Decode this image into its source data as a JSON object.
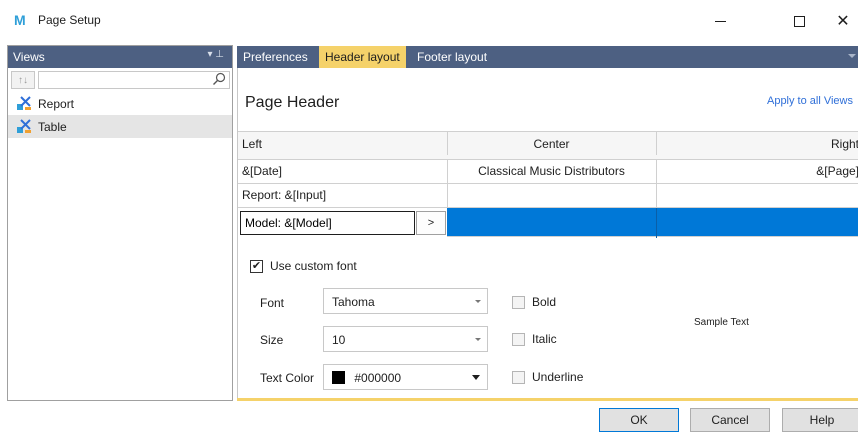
{
  "window": {
    "title": "Page Setup",
    "app_logo": "M",
    "minimize_icon": "minimize-icon",
    "maximize_icon": "maximize-icon",
    "close_icon": "close-icon",
    "close_glyph": "✕"
  },
  "views_panel": {
    "title": "Views",
    "header_controls": "▾ ⊥",
    "sort_glyph": "↑↓",
    "search_placeholder": "",
    "search_icon": "search-icon",
    "items": [
      {
        "label": "Report",
        "icon": "view-icon",
        "selected": false
      },
      {
        "label": "Table",
        "icon": "view-icon",
        "selected": true
      }
    ]
  },
  "tabs": [
    {
      "label": "Preferences",
      "active": false
    },
    {
      "label": "Header layout",
      "active": true
    },
    {
      "label": "Footer layout",
      "active": false
    }
  ],
  "header_layout": {
    "title": "Page Header",
    "apply_link": "Apply to all Views",
    "columns": [
      "Left",
      "Center",
      "Right"
    ],
    "rows": [
      [
        "&[Date]",
        "Classical Music Distributors",
        "&[Page]"
      ],
      [
        "Report: &[Input]",
        "",
        ""
      ]
    ],
    "editing_row": {
      "value": "Model: &[Model]",
      "button_label": ">"
    }
  },
  "font_options": {
    "use_custom_font_label": "Use custom font",
    "use_custom_font_checked": true,
    "font_label": "Font",
    "font_value": "Tahoma",
    "size_label": "Size",
    "size_value": "10",
    "text_color_label": "Text Color",
    "text_color_value": "#000000",
    "bold_label": "Bold",
    "italic_label": "Italic",
    "underline_label": "Underline",
    "sample_text": "Sample Text"
  },
  "buttons": {
    "ok": "OK",
    "cancel": "Cancel",
    "help": "Help"
  },
  "colors": {
    "header_bar": "#4d6082",
    "active_tab": "#f5d26a",
    "selection": "#0078d7",
    "link": "#2f6fd8"
  }
}
